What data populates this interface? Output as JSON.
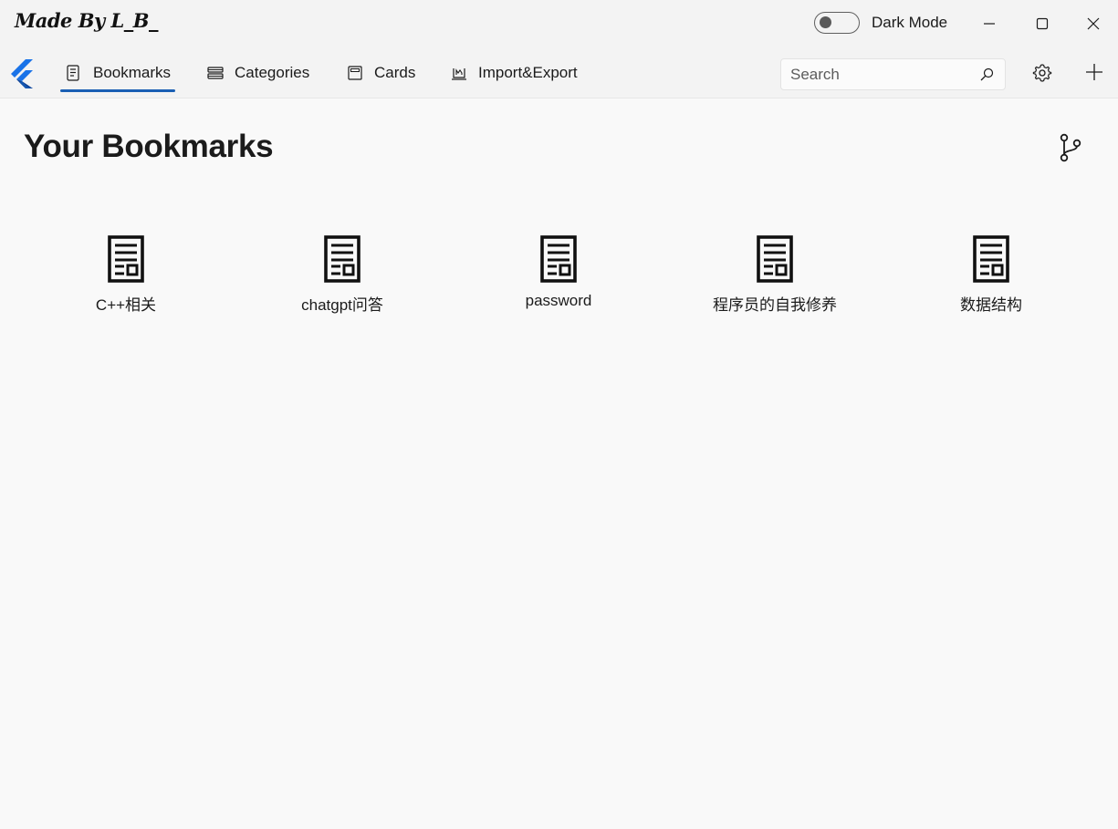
{
  "window": {
    "title": "Made By L_B_",
    "dark_mode_label": "Dark Mode",
    "dark_mode_on": false
  },
  "nav": {
    "tabs": [
      {
        "label": "Bookmarks",
        "icon": "document-icon",
        "active": true
      },
      {
        "label": "Categories",
        "icon": "list-icon",
        "active": false
      },
      {
        "label": "Cards",
        "icon": "card-icon",
        "active": false
      },
      {
        "label": "Import&Export",
        "icon": "import-export-icon",
        "active": false
      }
    ],
    "search": {
      "placeholder": "Search",
      "value": ""
    }
  },
  "main": {
    "title": "Your Bookmarks",
    "bookmarks": [
      {
        "label": "C++相关"
      },
      {
        "label": "chatgpt问答"
      },
      {
        "label": "password"
      },
      {
        "label": "程序员的自我修养"
      },
      {
        "label": "数据结构"
      }
    ]
  },
  "colors": {
    "accent": "#1a5fb4",
    "background": "#f9f9f9",
    "titlebar": "#f3f3f3"
  }
}
